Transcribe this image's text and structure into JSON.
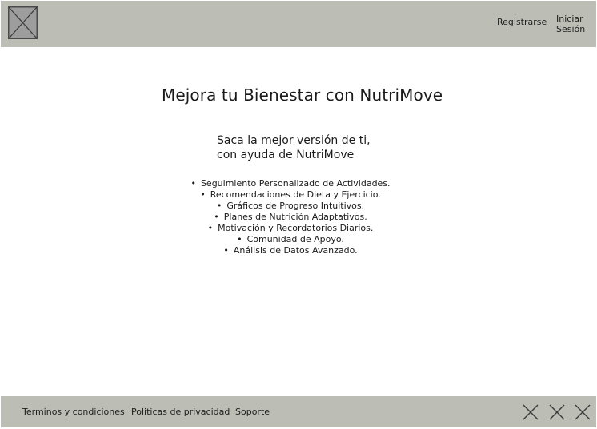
{
  "header": {
    "logo_icon": "placeholder-image-icon",
    "register_label": "Registrarse",
    "login_label_line1": "Iniciar",
    "login_label_line2": "Sesión"
  },
  "hero": {
    "title": "Mejora tu Bienestar con NutriMove",
    "subtitle_line1": "Saca la mejor versión de ti,",
    "subtitle_line2": "con ayuda de NutriMove",
    "bullet": "•",
    "features": [
      "Seguimiento Personalizado de Actividades.",
      "Recomendaciones de Dieta y Ejercicio.",
      "Gráficos de Progreso Intuitivos.",
      "Planes de Nutrición Adaptativos.",
      "Motivación y Recordatorios Diarios.",
      "Comunidad de Apoyo.",
      "Análisis de Datos Avanzado."
    ]
  },
  "footer": {
    "links": [
      "Terminos y condiciones",
      "Politicas de privacidad",
      "Soporte"
    ],
    "social_icons": [
      "placeholder-icon",
      "placeholder-icon",
      "placeholder-icon"
    ]
  },
  "colors": {
    "bar_background": "#bcbeb5",
    "page_background": "#ffffff",
    "text": "#1e1e1e"
  }
}
